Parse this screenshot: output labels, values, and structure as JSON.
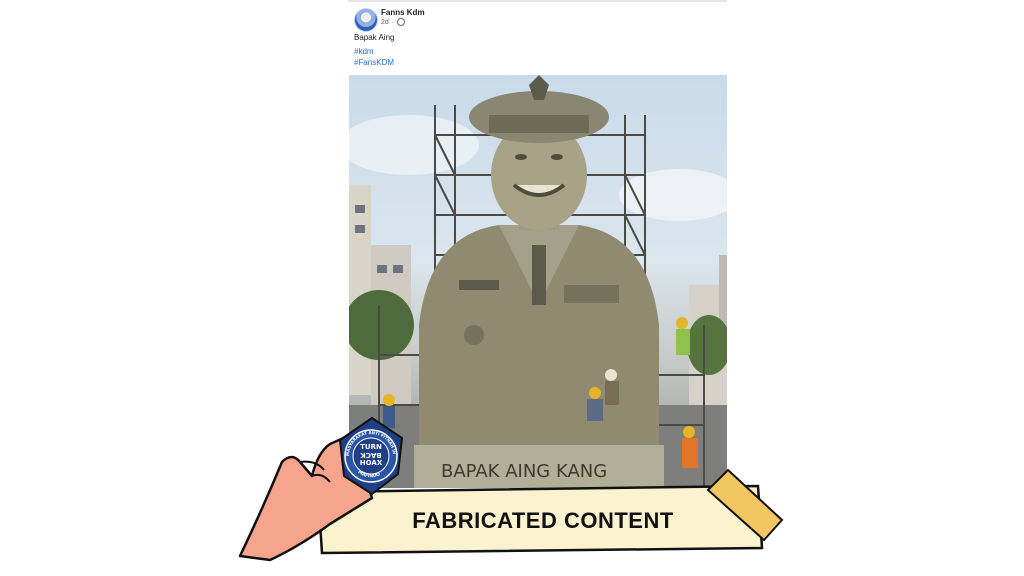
{
  "post": {
    "author": "Fanns Kdm",
    "time": "2d",
    "caption": "Bapak Aing",
    "hashtags": [
      "#kdm",
      "#FansKDM"
    ]
  },
  "photo": {
    "statue_plaque": "BAPAK AING KANG"
  },
  "overlay": {
    "label": "FABRICATED CONTENT",
    "badge_line1": "TURN",
    "badge_line2": "BACK",
    "badge_line3": "HOAX",
    "badge_ring_top": "MASYARAKAT ANTI FITNAH INDONESIA",
    "badge_ring_bottom": "MAFINDO"
  },
  "colors": {
    "hashtag": "#216fdb",
    "banner_fill": "#fbf3cf",
    "tape": "#f2c661",
    "hand": "#f6a48c",
    "badge": "#1f3f86"
  }
}
